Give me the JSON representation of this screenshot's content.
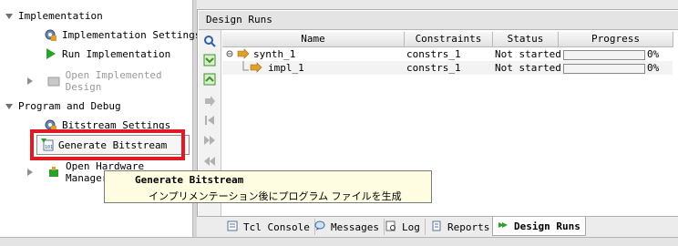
{
  "nav": {
    "implementation": {
      "header": "Implementation",
      "items": [
        {
          "label": "Implementation Settings",
          "icon": "gear-icon"
        },
        {
          "label": "Run Implementation",
          "icon": "play-icon"
        },
        {
          "label": "Open Implemented Design",
          "icon": "open-design-icon",
          "disabled": true
        }
      ]
    },
    "program": {
      "header": "Program and Debug",
      "items": [
        {
          "label": "Bitstream Settings",
          "icon": "gear-icon"
        },
        {
          "label": "Generate Bitstream",
          "icon": "bitstream-icon"
        },
        {
          "label": "Open Hardware Manager",
          "icon": "hardware-manager-icon"
        }
      ]
    }
  },
  "panel": {
    "title": "Design Runs",
    "columns": [
      "Name",
      "Constraints",
      "Status",
      "Progress"
    ],
    "rows": [
      {
        "name": "synth_1",
        "constraints": "constrs_1",
        "status": "Not started",
        "progress": "0%",
        "progress_value": 0
      },
      {
        "name": "impl_1",
        "constraints": "constrs_1",
        "status": "Not started",
        "progress": "0%",
        "progress_value": 0
      }
    ]
  },
  "tabs": [
    {
      "label": "Tcl Console",
      "icon": "console-icon"
    },
    {
      "label": "Messages",
      "icon": "messages-icon"
    },
    {
      "label": "Log",
      "icon": "log-icon"
    },
    {
      "label": "Reports",
      "icon": "reports-icon"
    },
    {
      "label": "Design Runs",
      "icon": "design-runs-icon",
      "active": true
    }
  ],
  "tooltip": {
    "title": "Generate Bitstream",
    "description": "インプリメンテーション後にプログラム ファイルを生成"
  },
  "colors": {
    "highlight": "#e01a22",
    "tooltip_bg": "#fffde1",
    "accent_green": "#2aa12a",
    "run_arrow": "#e0a02c"
  }
}
